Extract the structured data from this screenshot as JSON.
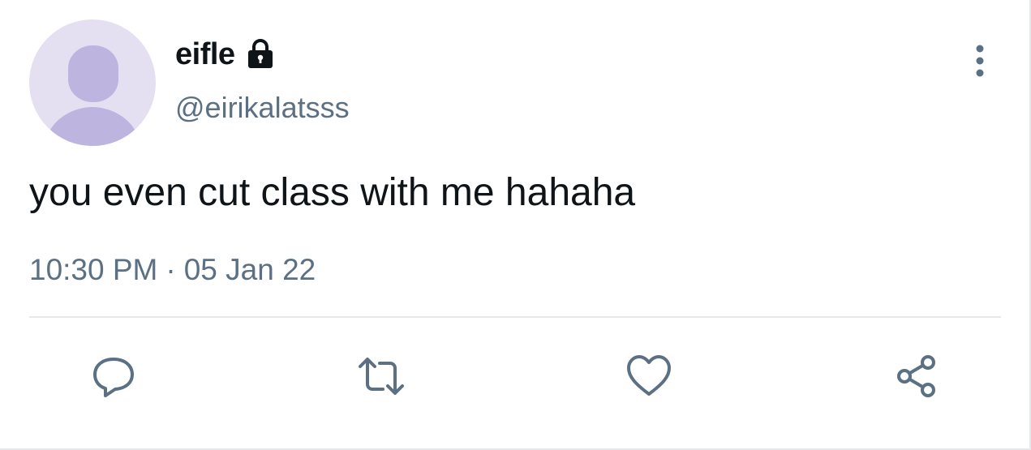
{
  "tweet": {
    "display_name": "eifle",
    "handle": "@eirikalatsss",
    "text": "you even cut class with me hahaha",
    "time": "10:30 PM",
    "separator": "·",
    "date": "05 Jan 22",
    "protected": true
  },
  "icons": {
    "avatar": "default-avatar-silhouette",
    "lock": "lock-icon",
    "more": "more-vertical-icon",
    "reply": "reply-icon",
    "retweet": "retweet-icon",
    "like": "heart-icon",
    "share": "share-icon"
  },
  "colors": {
    "avatar_bg": "#e4e0f1",
    "avatar_figure": "#bdb5e0",
    "text_primary": "#0f1419",
    "text_secondary": "#5b7083",
    "divider": "#e6e9ec"
  }
}
